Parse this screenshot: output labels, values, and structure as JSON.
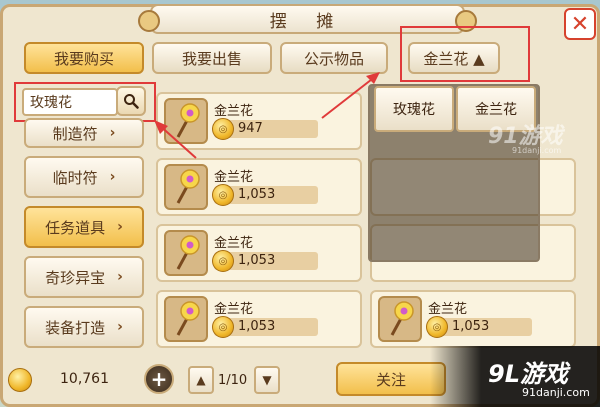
{
  "window": {
    "title": "摆 摊"
  },
  "tabs": [
    {
      "label": "我要购买",
      "active": true
    },
    {
      "label": "我要出售",
      "active": false
    },
    {
      "label": "公示物品",
      "active": false
    },
    {
      "label": "金兰花 ▲",
      "active": false
    }
  ],
  "search": {
    "value": "玫瑰花",
    "icon": "search-icon"
  },
  "categories": [
    {
      "label": "制造符"
    },
    {
      "label": "临时符"
    },
    {
      "label": "任务道具"
    },
    {
      "label": "奇珍异宝"
    },
    {
      "label": "装备打造"
    }
  ],
  "items": [
    {
      "name": "金兰花",
      "price": "947"
    },
    {
      "name": "金兰花",
      "price": "1,053"
    },
    {
      "name": "金兰花",
      "price": "1,053"
    },
    {
      "name": "金兰花",
      "price": "1,053"
    },
    {
      "name": "金兰花",
      "price": "1,053"
    }
  ],
  "dropdown": {
    "options": [
      "玫瑰花",
      "金兰花"
    ]
  },
  "footer": {
    "money": "10,761",
    "page": "1/10",
    "follow_label": "关注"
  },
  "watermark": {
    "top_logo": "91游戏",
    "top_url": "91danji.com",
    "corner_logo": "9L游戏",
    "corner_url": "91danji.com"
  },
  "colors": {
    "accent": "#f2bf4b",
    "highlight": "#e03a3a",
    "panel": "#efe6cf"
  }
}
